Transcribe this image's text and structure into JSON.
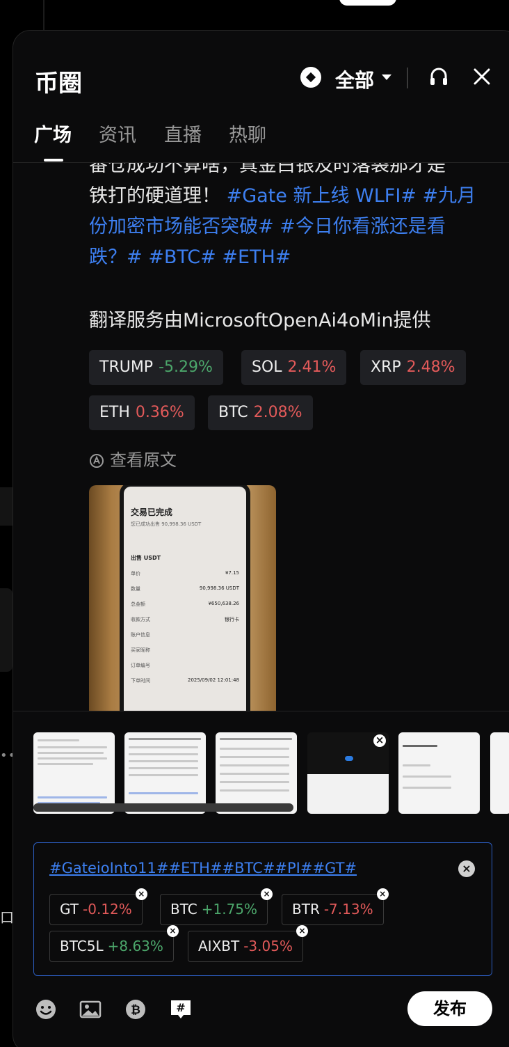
{
  "header": {
    "title": "币圈",
    "filter_label": "全部"
  },
  "tabs": [
    {
      "label": "广场",
      "active": true
    },
    {
      "label": "资讯",
      "active": false
    },
    {
      "label": "直播",
      "active": false
    },
    {
      "label": "热聊",
      "active": false
    }
  ],
  "post": {
    "text_line1": "番仓成功不算啥，真金白银及时落袋那才是",
    "text_line2_plain": "铁打的硬道理！ ",
    "text_line2_hash": "#Gate 新上线 WLFI# #九月",
    "text_line3_hash": "份加密市场能否突破# #今日你看涨还是看",
    "text_line4_hash": "跌？# #BTC# #ETH#",
    "translate_note": "翻译服务由MicrosoftOpenAi4oMin提供",
    "tickers": [
      {
        "symbol": "TRUMP",
        "change": "-5.29%",
        "trend": "up"
      },
      {
        "symbol": "SOL",
        "change": "2.41%",
        "trend": "down"
      },
      {
        "symbol": "XRP",
        "change": "2.48%",
        "trend": "down"
      },
      {
        "symbol": "ETH",
        "change": "0.36%",
        "trend": "down"
      },
      {
        "symbol": "BTC",
        "change": "2.08%",
        "trend": "down"
      }
    ],
    "view_original": "查看原文",
    "photo": {
      "title": "交易已完成",
      "subtitle": "您已成功出售 90,998.36 USDT",
      "section": "出售 USDT",
      "rows": [
        {
          "label": "单价",
          "value": "¥7.15"
        },
        {
          "label": "数量",
          "value": "90,998.36 USDT"
        },
        {
          "label": "总金额",
          "value": "¥650,638.26"
        },
        {
          "label": "收款方式",
          "value": "银行卡"
        },
        {
          "label": "账户信息",
          "value": ""
        },
        {
          "label": "买家昵称",
          "value": ""
        },
        {
          "label": "订单编号",
          "value": ""
        },
        {
          "label": "下单时间",
          "value": "2025/09/02 12:01:48"
        }
      ]
    }
  },
  "compose": {
    "hashtags": "#GateioInto11##ETH##BTC##PI##GT#",
    "tags": [
      {
        "symbol": "GT",
        "change": "-0.12%",
        "trend": "down"
      },
      {
        "symbol": "BTC",
        "change": "+1.75%",
        "trend": "up"
      },
      {
        "symbol": "BTR",
        "change": "-7.13%",
        "trend": "down"
      },
      {
        "symbol": "BTC5L",
        "change": "+8.63%",
        "trend": "up"
      },
      {
        "symbol": "AIXBT",
        "change": "-3.05%",
        "trend": "down"
      }
    ],
    "publish_label": "发布"
  },
  "colors": {
    "up": "#4ca76b",
    "down": "#e35a5a",
    "link": "#3d7ff0"
  }
}
